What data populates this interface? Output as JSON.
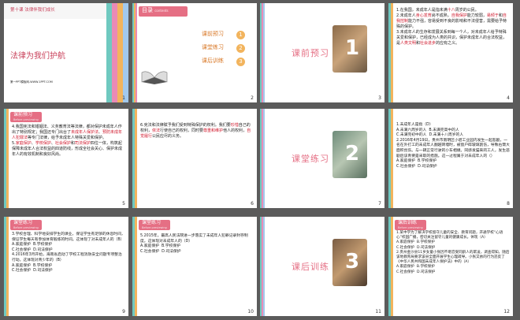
{
  "slides": [
    {
      "n": "1",
      "course": "第十课 法律伴我们成长",
      "title": "法律为我们护航",
      "site": "第一PPT模板网-WWW.1PPT.COM"
    },
    {
      "n": "2",
      "header": "目录",
      "header_en": "contents",
      "items": [
        "课前预习",
        "课堂练习",
        "课后训练"
      ],
      "nums": [
        "1",
        "2",
        "3"
      ]
    },
    {
      "n": "3",
      "big_num": "1",
      "label": "课前预习"
    },
    {
      "n": "4",
      "lines": [
        "1.在我国，未成年人是指未满",
        "十八",
        "周岁的公民。",
        "2.未成年人",
        "身心发育",
        "尚不成熟，",
        "自我保护",
        "能力较弱，",
        "易倾于",
        "和",
        "自我控制",
        "能力不强，容易受到不良的影响和不法侵害，需要给予特殊的保护。",
        "3.未成年人的生存和发展关系到每一个人，对未成年人给予特殊关爱和保护，已经成为人类的共识，保护未成年人的合法权益，是",
        "人类文明",
        "和",
        "社会进步",
        "的应有之义。"
      ]
    },
    {
      "n": "5",
      "header": "课前预习",
      "header_en": "Before previewing",
      "lines": [
        "4.我国宪法和婚姻法、义务教育法等法律，都对保护未成年人作出了特别规定；我国还专门出台了",
        "未成年人保护法",
        "、",
        "预防未成年人犯罪法",
        "等专门法律，给予未成年人特殊关爱和保护。",
        "5.",
        "家庭保护",
        "、",
        "学校保护",
        "、",
        "社会保护",
        "和",
        "司法保护",
        "四位一体，构筑起保障未成年人合法权益的四道防线，形成全社会关心、保护未成年人的有效机制和良好风尚。"
      ]
    },
    {
      "n": "6",
      "lines": [
        "6.宪法和法律赋予我们受到特殊保护的权利。我们要",
        "珍惜",
        "自己的权利，",
        "依法",
        "行使自己的权利，同时要",
        "尊重和维护",
        "他人的权利，",
        "自觉履行",
        "公民应尽的义务。"
      ]
    },
    {
      "n": "7",
      "big_num": "2",
      "label": "课堂练习"
    },
    {
      "n": "8",
      "lines": [
        "1.未成年人是指（D）",
        "A.未满六周岁的人",
        "B.未满完高中的人",
        "C.未满完初中的人",
        "D.未满十八周岁的人",
        "2.2016年4月19日，贵州市南明区小碧工业园内发生一起悲剧，一名在外打工的未成年人翻越砖墙时，被窗户碎玻璃割伤，导致右臂大面积创伤。与一辆正常行驶的小车相撞。同感发猫来的工人，发生悲剧后该青要是采取的措施。这一过程属于对未成年人的（）",
        "A.家庭保护",
        "B.学校保护",
        "C.社会保护",
        "D.司法保护"
      ]
    },
    {
      "n": "9",
      "header": "课堂练习",
      "header_en": "Before previewing",
      "lines": [
        "3.学校合理、科学地安排学生的课业，保证学生有足够的休息时间，保证学生每天有参加体育锻炼的时间。这体现了对未成年人的（B）",
        "A.家庭保护",
        "B.学校保护",
        "C.社会保护",
        "D.司法保护",
        "4.2016年3月开始，海南省启动了学校工程消防安全问题专项整治行动。这体现对青少年的（B）",
        "A.家庭保护",
        "B.学校保护",
        "C.社会保护",
        "D.司法保护"
      ]
    },
    {
      "n": "10",
      "header": "课堂练习",
      "header_en": "Before previewing",
      "lines": [
        "5.2015年，最高人民法院进一步落实了未成年人犯罪记录封存制度。这体现对未成年人的（D）",
        "A.家庭保护",
        "B.学校保护",
        "C.社会保护",
        "D.司法保护"
      ]
    },
    {
      "n": "11",
      "big_num": "3",
      "label": "课后训练"
    },
    {
      "n": "12",
      "header": "课后训练",
      "header_en": "Before previewing",
      "lines": [
        "1.某中学为了解决学校留守儿童的安全、教育问题，开通学校“心语心”校园广播，密切关注留守儿童的健康成长。体现（A）",
        "A.家庭保护",
        "B.学校保护",
        "C.社会保护",
        "D.司法保护",
        "2.贵州金沙县11岁女童小张因不堪忍受同龄人的欺凌，调查得知，随后该地教育局要求该县全面开展学生心理疏导。小张又依的行为违反了《中华人民共和国未成年人保护法》中的（A）",
        "A.家庭保护",
        "B.学校保护",
        "C.社会保护",
        "D.司法保护"
      ]
    }
  ],
  "colors": {
    "pink": "#e56f84",
    "stripe": [
      "#6fc9c0",
      "#f2b45d",
      "#e98ab6",
      "#a2c9ed",
      "#f6d86b"
    ]
  }
}
